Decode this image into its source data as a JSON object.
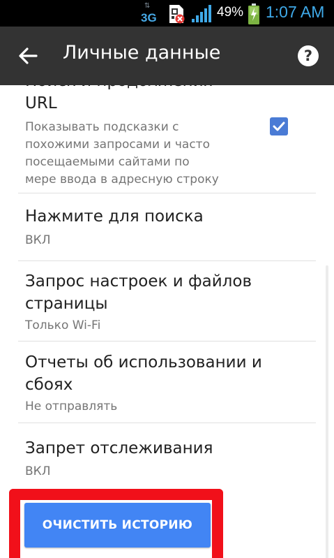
{
  "status_bar": {
    "network": "3G",
    "battery_percent": "49%",
    "time": "1:07 AM",
    "icons": [
      "data-arrows-icon",
      "sim-card-error-icon",
      "signal-icon",
      "battery-charging-icon"
    ]
  },
  "toolbar": {
    "title": "Личные данные",
    "back_icon": "arrow-back-icon",
    "help_icon": "help-icon"
  },
  "settings": [
    {
      "title_lines": [
        "Поиск и продолжения",
        "URL"
      ],
      "subtitle_lines": [
        "Показывать подсказки с",
        "похожими запросами и часто",
        "посещаемыми сайтами по",
        "мере ввода в адресную строку"
      ],
      "checked": true
    },
    {
      "title_lines": [
        "Нажмите для поиска"
      ],
      "subtitle_lines": [
        "ВКЛ"
      ]
    },
    {
      "title_lines": [
        "Запрос настроек и файлов",
        "страницы"
      ],
      "subtitle_lines": [
        "Только Wi-Fi"
      ]
    },
    {
      "title_lines": [
        "Отчеты об использовании и",
        "сбоях"
      ],
      "subtitle_lines": [
        "Не отправлять"
      ]
    },
    {
      "title_lines": [
        "Запрет отслеживания"
      ],
      "subtitle_lines": [
        "ВКЛ"
      ]
    }
  ],
  "clear_history": {
    "label": "ОЧИСТИТЬ ИСТОРИЮ"
  },
  "colors": {
    "toolbar": "#333333",
    "accent": "#4285f4",
    "highlight": "#f1101a",
    "checkbox": "#4a7bd5"
  }
}
